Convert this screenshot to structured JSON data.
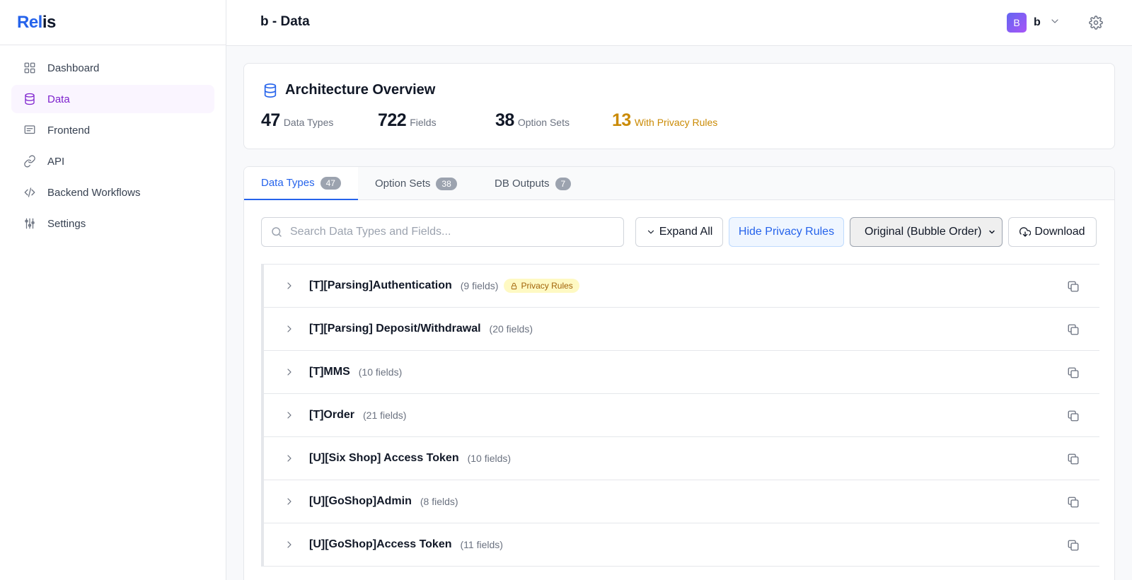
{
  "app": {
    "logo_a": "Rel",
    "logo_b": "is"
  },
  "sidebar": {
    "items": [
      {
        "label": "Dashboard",
        "icon": "grid-icon"
      },
      {
        "label": "Data",
        "icon": "database-icon",
        "active": true
      },
      {
        "label": "Frontend",
        "icon": "monitor-icon"
      },
      {
        "label": "API",
        "icon": "link-icon"
      },
      {
        "label": "Backend Workflows",
        "icon": "code-icon"
      },
      {
        "label": "Settings",
        "icon": "sliders-icon"
      }
    ]
  },
  "header": {
    "title": "b - Data",
    "user_initial": "B",
    "user_name": "b"
  },
  "overview": {
    "title": "Architecture Overview",
    "stats": [
      {
        "value": "47",
        "label": "Data Types"
      },
      {
        "value": "722",
        "label": "Fields"
      },
      {
        "value": "38",
        "label": "Option Sets"
      },
      {
        "value": "13",
        "label": "With Privacy Rules"
      }
    ]
  },
  "tabs": [
    {
      "label": "Data Types",
      "count": "47"
    },
    {
      "label": "Option Sets",
      "count": "38"
    },
    {
      "label": "DB Outputs",
      "count": "7"
    }
  ],
  "toolbar": {
    "search_placeholder": "Search Data Types and Fields...",
    "expand_label": "Expand All",
    "privacy_label": "Hide Privacy Rules",
    "sort_selected": "Original (Bubble Order)",
    "download_label": "Download"
  },
  "data_types": [
    {
      "name": "[T][Parsing]Authentication",
      "fields": "(9 fields)",
      "privacy": "Privacy Rules"
    },
    {
      "name": "[T][Parsing] Deposit/Withdrawal",
      "fields": "(20 fields)"
    },
    {
      "name": "[T]MMS",
      "fields": "(10 fields)"
    },
    {
      "name": "[T]Order",
      "fields": "(21 fields)"
    },
    {
      "name": "[U][Six Shop] Access Token",
      "fields": "(10 fields)"
    },
    {
      "name": "[U][GoShop]Admin",
      "fields": "(8 fields)"
    },
    {
      "name": "[U][GoShop]Access Token",
      "fields": "(11 fields)"
    }
  ],
  "colors": {
    "accent": "#2563eb",
    "active_nav": "#7e22ce",
    "warning": "#ca8a04"
  }
}
